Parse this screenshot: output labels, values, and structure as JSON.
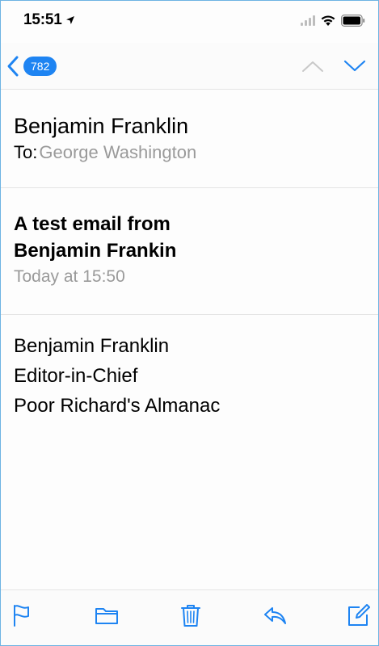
{
  "status_bar": {
    "time": "15:51",
    "icons": [
      "location-arrow-icon",
      "signal-icon",
      "wifi-icon",
      "battery-icon"
    ]
  },
  "nav": {
    "back_icon": "chevron-left-icon",
    "unread_count": "782",
    "prev_icon": "chevron-up-icon",
    "next_icon": "chevron-down-icon"
  },
  "email": {
    "from": "Benjamin Franklin",
    "to_label": "To:",
    "to": "George Washington",
    "subject": "A test email from Benjamin Frankin",
    "date": "Today at 15:50",
    "body": [
      "Benjamin Franklin",
      "Editor-in-Chief",
      "Poor Richard's Almanac"
    ]
  },
  "toolbar": {
    "items": [
      "flag-icon",
      "folder-icon",
      "trash-icon",
      "reply-icon",
      "compose-icon"
    ]
  },
  "colors": {
    "accent": "#1e84f2",
    "secondary_text": "#9a9a9a",
    "separator": "#e4e4e4",
    "disabled_arrow": "#c8c8c8"
  }
}
